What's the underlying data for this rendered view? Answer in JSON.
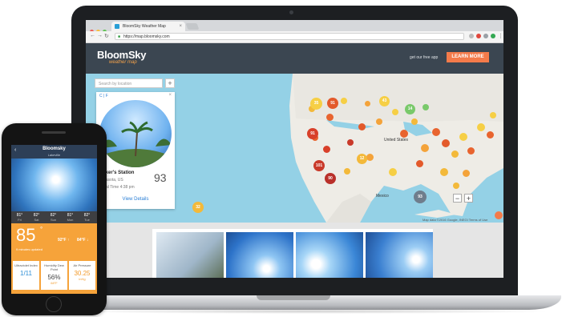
{
  "browser": {
    "tab_title": "BloomSky Weather Map",
    "url": "https://map.bloomsky.com"
  },
  "site": {
    "logo": "BloomSky",
    "logo_sub": "weather map",
    "get_app": "get our free app",
    "learn_more": "LEARN MORE"
  },
  "map": {
    "search_placeholder": "Search by location",
    "plus": "+",
    "zoom_in": "+",
    "zoom_out": "−",
    "attribution": "Map data ©2016 Google, INEGI  Terms of Use",
    "cities": {
      "united_states": "United States",
      "mexico": "Mexico"
    },
    "clusters": [
      "35",
      "91",
      "91",
      "93",
      "43",
      "14",
      "12",
      "101",
      "90",
      "32"
    ]
  },
  "station_card": {
    "unit_toggle": "C | F",
    "close": "×",
    "name": "Baker's Station",
    "location": "Sarasota, US",
    "time": "Local Time   4:38 pm",
    "temp": "93",
    "view_details": "View Details"
  },
  "phone": {
    "title": "Bloomsky",
    "subtitle": "Lakeville",
    "back": "‹",
    "forecast": [
      {
        "t": "81°",
        "d": "Fri"
      },
      {
        "t": "82°",
        "d": "Sat"
      },
      {
        "t": "82°",
        "d": "Sun"
      },
      {
        "t": "81°",
        "d": "Mon"
      },
      {
        "t": "82°",
        "d": "Tue"
      }
    ],
    "temp": "85",
    "deg": "°",
    "updated": "9 minutes updated",
    "hi": "92°F ↑",
    "lo": "84°F ↓",
    "stats": [
      {
        "label": "Ultraviolet Index",
        "value": "1/11",
        "note": ""
      },
      {
        "label": "Humidity Dew Point",
        "value": "56%",
        "note": "68°F"
      },
      {
        "label": "Air Pressure",
        "value": "30.25",
        "note": "inHg"
      }
    ]
  },
  "colors": {
    "accent": "#f47b4a",
    "header": "#3b4651",
    "water": "#94d1e6",
    "phone_orange": "#f6a33a"
  }
}
